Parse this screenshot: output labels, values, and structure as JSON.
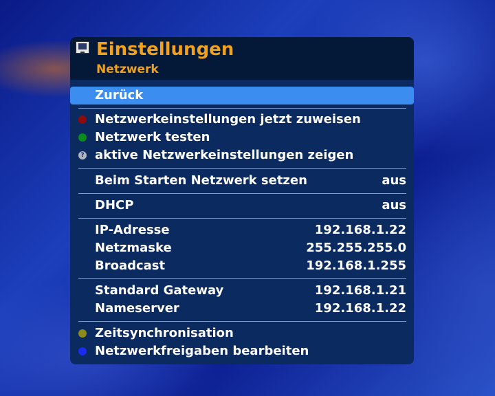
{
  "header": {
    "title": "Einstellungen",
    "subtitle": "Netzwerk",
    "icon": "settings-tv-icon"
  },
  "menu": {
    "back": "Zurück",
    "assign_now": "Netzwerkeinstellungen jetzt zuweisen",
    "test_network": "Netzwerk testen",
    "show_active": "aktive Netzwerkeinstellungen zeigen",
    "help_glyph": "?",
    "set_on_start": {
      "label": "Beim Starten Netzwerk setzen",
      "value": "aus"
    },
    "dhcp": {
      "label": "DHCP",
      "value": "aus"
    },
    "ip": {
      "label": "IP-Adresse",
      "value": "192.168.1.22"
    },
    "netmask": {
      "label": "Netzmaske",
      "value": "255.255.255.0"
    },
    "broadcast": {
      "label": "Broadcast",
      "value": "192.168.1.255"
    },
    "gateway": {
      "label": "Standard Gateway",
      "value": "192.168.1.21"
    },
    "nameserver": {
      "label": "Nameserver",
      "value": "192.168.1.22"
    },
    "timesync": "Zeitsynchronisation",
    "shares": "Netzwerkfreigaben bearbeiten"
  },
  "colors": {
    "accent": "#f0a21e",
    "selection": "#3c8df0",
    "red": "#8e0b0b",
    "green": "#0d8a1e",
    "yellow": "#8c8a18",
    "blue": "#1a2cf0"
  }
}
